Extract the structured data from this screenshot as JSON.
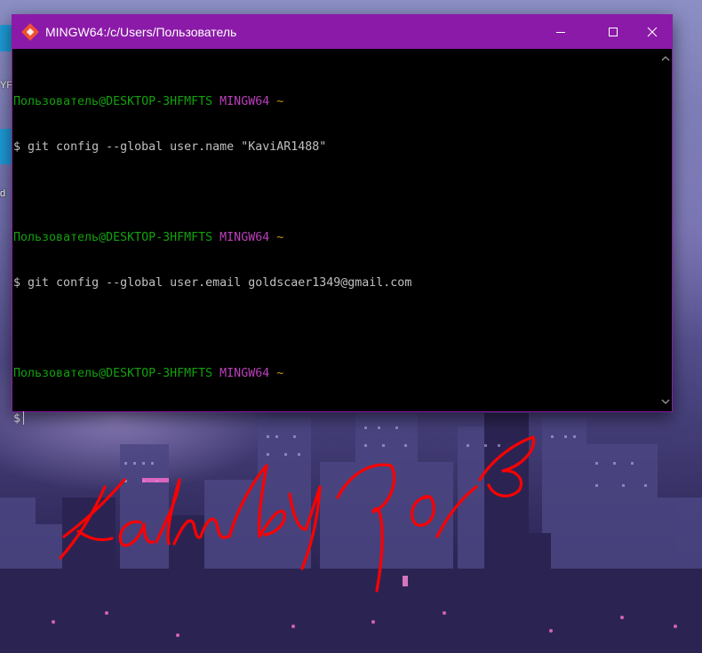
{
  "window": {
    "title": "MINGW64:/c/Users/Пользователь",
    "titlebar_color": "#8b1aa8",
    "controls": [
      "minimize-icon",
      "maximize-icon",
      "close-icon"
    ]
  },
  "terminal": {
    "background": "#000000",
    "lines": [
      {
        "user": "Пользователь@DESKTOP-3HFMFTS",
        "system": "MINGW64",
        "dir": "~"
      },
      {
        "prompt": "$",
        "command": "git config --global user.name \"KaviAR1488\""
      },
      {
        "user": "Пользователь@DESKTOP-3HFMFTS",
        "system": "MINGW64",
        "dir": "~"
      },
      {
        "prompt": "$",
        "command": "git config --global user.email goldscaer1349@gmail.com"
      },
      {
        "user": "Пользователь@DESKTOP-3HFMFTS",
        "system": "MINGW64",
        "dir": "~"
      },
      {
        "prompt": "$",
        "command": ""
      }
    ],
    "colors": {
      "user": "#13a10e",
      "system": "#bc3fbc",
      "dir": "#c19c00",
      "text": "#c0c0c0"
    }
  },
  "desktop": {
    "edge_labels": [
      "YP",
      "d"
    ]
  },
  "overlay": {
    "handwriting": "Kalmbipob",
    "color": "#ff0000"
  }
}
